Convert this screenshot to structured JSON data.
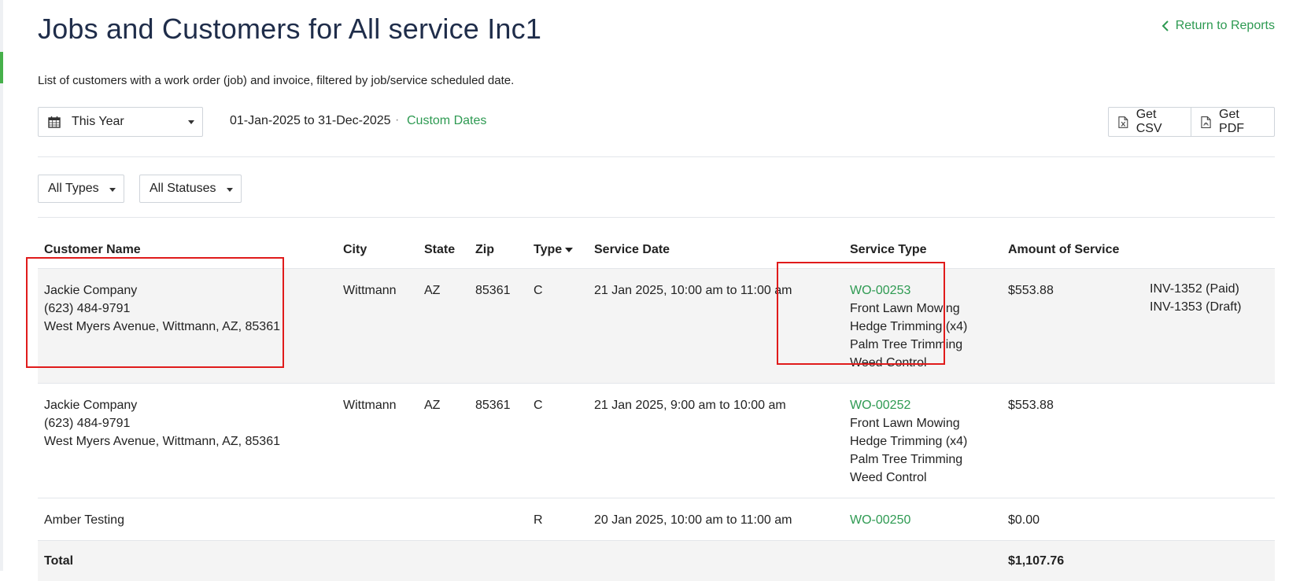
{
  "page": {
    "title": "Jobs and Customers for All service Inc1",
    "return_label": "Return to Reports",
    "subtitle": "List of customers with a work order (job) and invoice, filtered by job/service scheduled date."
  },
  "date_filter": {
    "period_label": "This Year",
    "range_text": "01-Jan-2025 to 31-Dec-2025",
    "separator": "·",
    "custom_dates_label": "Custom Dates"
  },
  "export": {
    "csv_label": "Get CSV",
    "pdf_label": "Get PDF"
  },
  "filters": {
    "types_label": "All Types",
    "statuses_label": "All Statuses"
  },
  "table": {
    "columns": {
      "customer_name": "Customer Name",
      "city": "City",
      "state": "State",
      "zip": "Zip",
      "type": "Type",
      "service_date": "Service Date",
      "service_type": "Service Type",
      "amount": "Amount of Service"
    },
    "rows": [
      {
        "customer": "Jackie Company",
        "phone": "(623) 484-9791",
        "address": "West Myers Avenue, Wittmann, AZ, 85361",
        "city": "Wittmann",
        "state": "AZ",
        "zip": "85361",
        "type": "C",
        "service_date": "21 Jan 2025, 10:00 am to 11:00 am",
        "work_order": "WO-00253",
        "services": [
          "Front Lawn Mowing",
          "Hedge Trimming (x4)",
          "Palm Tree Trimming",
          "Weed Control"
        ],
        "amount": "$553.88",
        "invoices": [
          "INV-1352 (Paid)",
          "INV-1353 (Draft)"
        ]
      },
      {
        "customer": "Jackie Company",
        "phone": "(623) 484-9791",
        "address": "West Myers Avenue, Wittmann, AZ, 85361",
        "city": "Wittmann",
        "state": "AZ",
        "zip": "85361",
        "type": "C",
        "service_date": "21 Jan 2025, 9:00 am to 10:00 am",
        "work_order": "WO-00252",
        "services": [
          "Front Lawn Mowing",
          "Hedge Trimming (x4)",
          "Palm Tree Trimming",
          "Weed Control"
        ],
        "amount": "$553.88",
        "invoices": []
      },
      {
        "customer": "Amber Testing",
        "phone": "",
        "address": "",
        "city": "",
        "state": "",
        "zip": "",
        "type": "R",
        "service_date": "20 Jan 2025, 10:00 am to 11:00 am",
        "work_order": "WO-00250",
        "services": [],
        "amount": "$0.00",
        "invoices": []
      }
    ],
    "total_label": "Total",
    "total_amount": "$1,107.76"
  },
  "colors": {
    "accent_green": "#2e9a52",
    "title_navy": "#1f2d4a",
    "highlight_red": "#e01b1b"
  },
  "icons": [
    "calendar-icon",
    "chevron-left-icon",
    "csv-file-icon",
    "pdf-file-icon",
    "caret-down-icon",
    "sort-desc-icon"
  ]
}
